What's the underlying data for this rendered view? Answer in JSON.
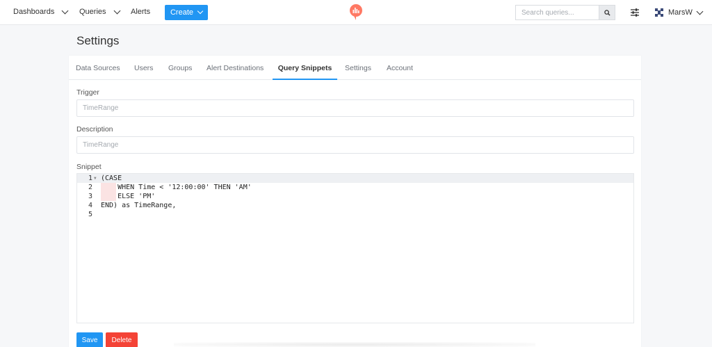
{
  "navbar": {
    "dashboards": "Dashboards",
    "queries": "Queries",
    "alerts": "Alerts",
    "create": "Create",
    "search_placeholder": "Search queries...",
    "user_name": "MarsW",
    "brand_color": "#ff7964",
    "accent": "#2196f3"
  },
  "page": {
    "title": "Settings"
  },
  "tabs": [
    {
      "label": "Data Sources",
      "active": false
    },
    {
      "label": "Users",
      "active": false
    },
    {
      "label": "Groups",
      "active": false
    },
    {
      "label": "Alert Destinations",
      "active": false
    },
    {
      "label": "Query Snippets",
      "active": true
    },
    {
      "label": "Settings",
      "active": false
    },
    {
      "label": "Account",
      "active": false
    }
  ],
  "form": {
    "trigger_label": "Trigger",
    "trigger_value": "TimeRange",
    "description_label": "Description",
    "description_value": "TimeRange",
    "snippet_label": "Snippet"
  },
  "editor": {
    "lines": [
      {
        "num": "1",
        "code": "(CASE"
      },
      {
        "num": "2",
        "code": "    WHEN Time < '12:00:00' THEN 'AM'"
      },
      {
        "num": "3",
        "code": "    ELSE 'PM'"
      },
      {
        "num": "4",
        "code": "END) as TimeRange,"
      },
      {
        "num": "5",
        "code": ""
      }
    ]
  },
  "buttons": {
    "save": "Save",
    "delete": "Delete"
  }
}
